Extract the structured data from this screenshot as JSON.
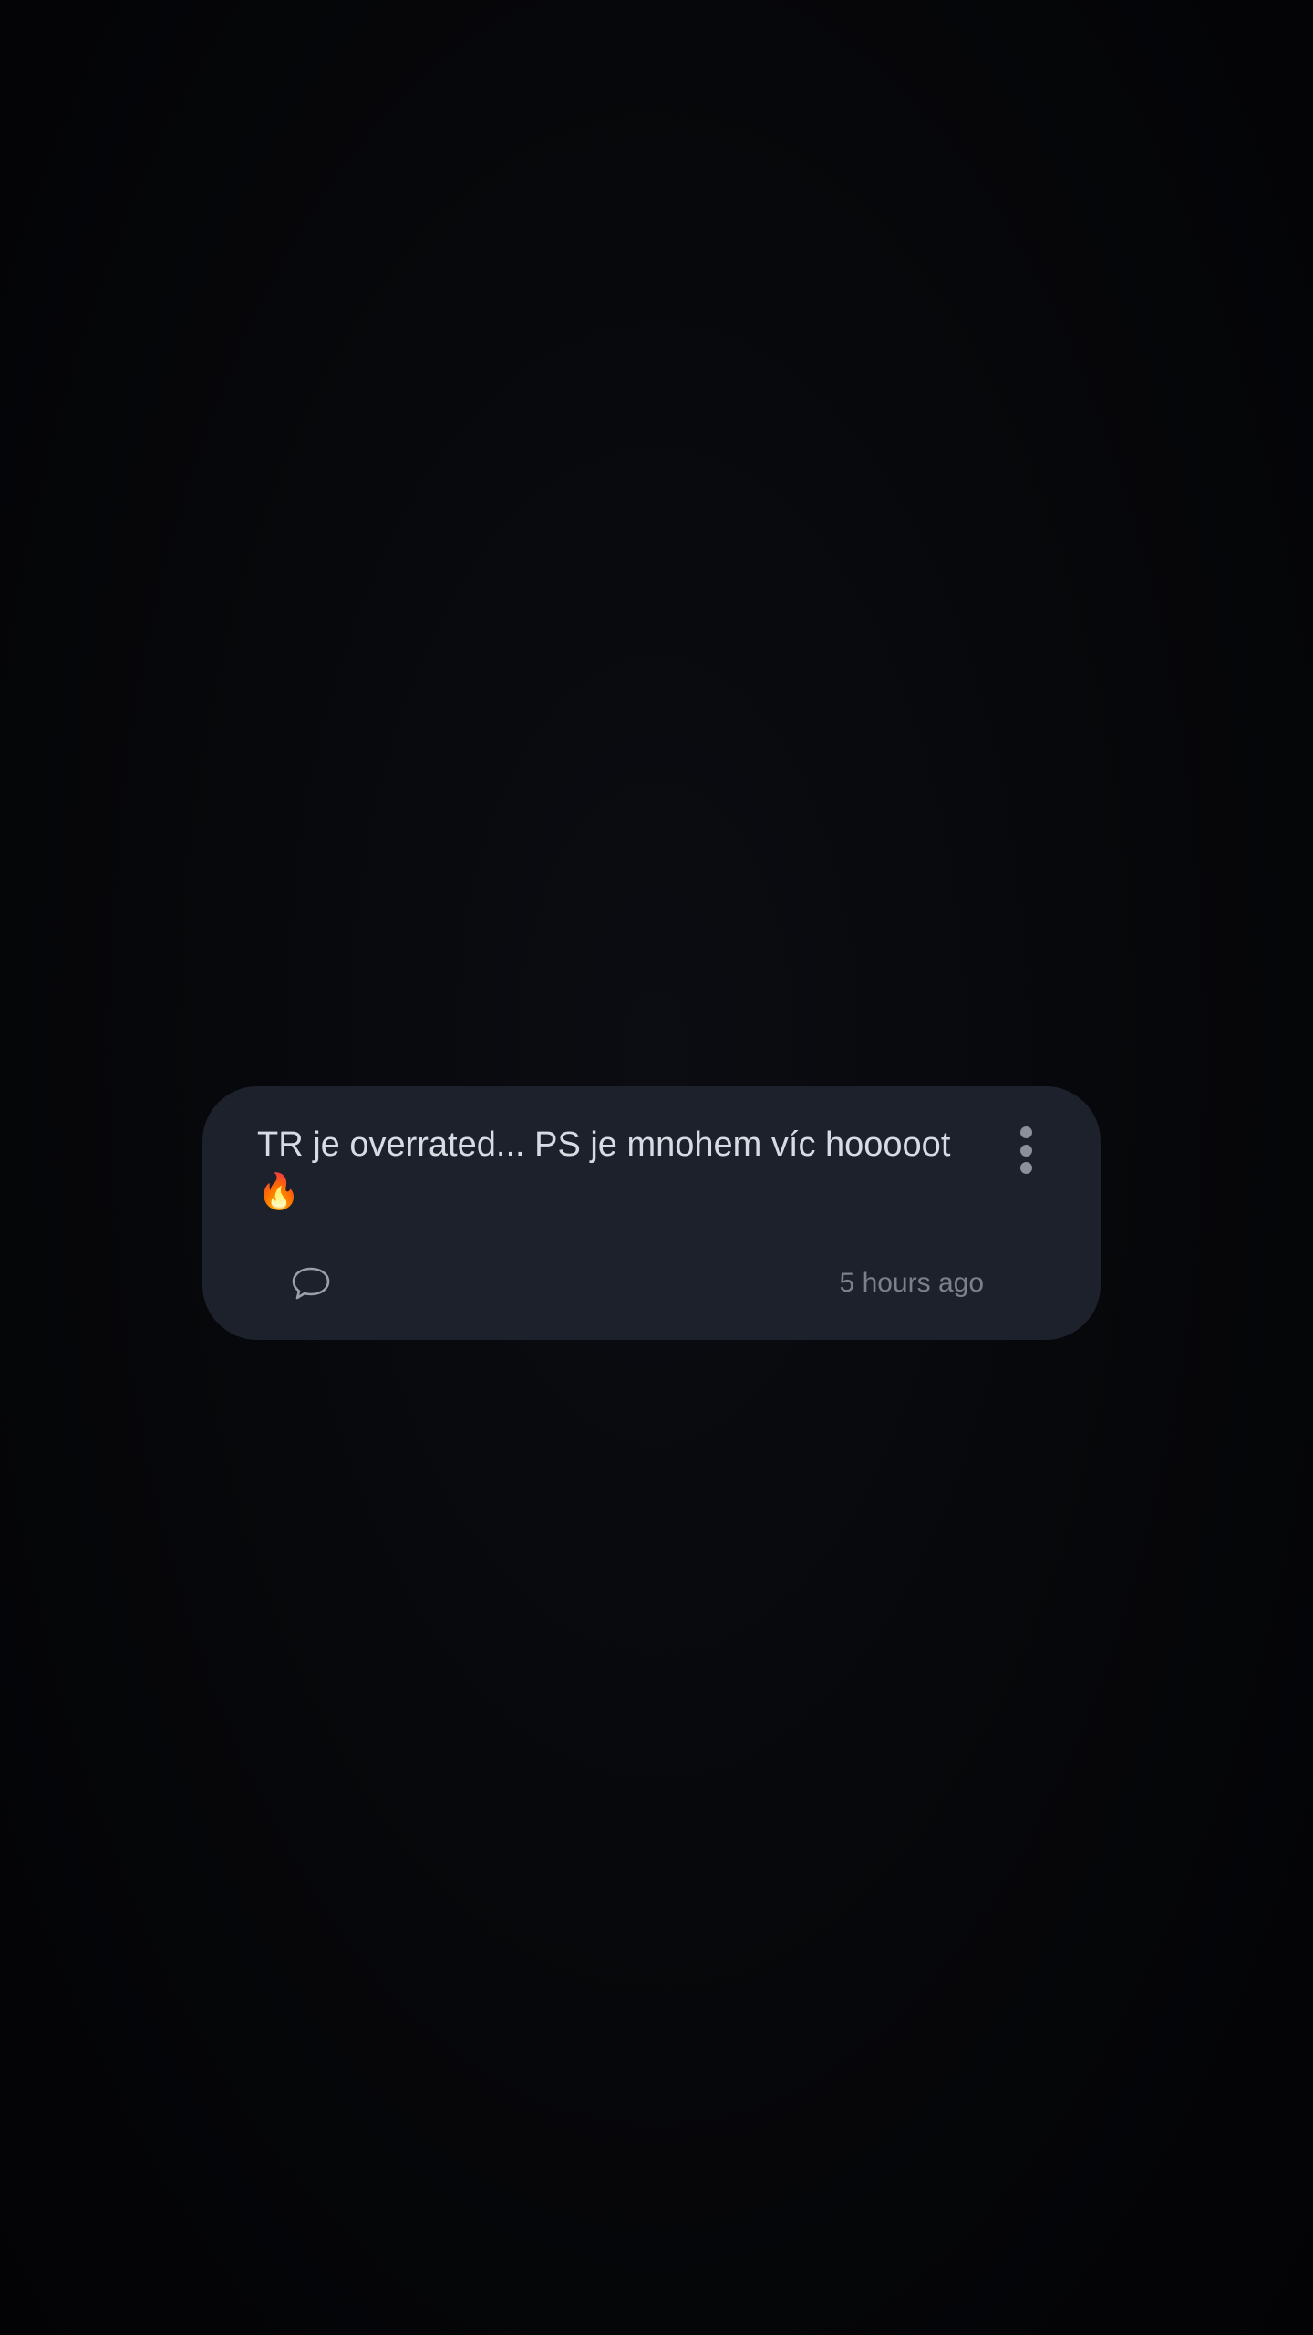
{
  "post": {
    "text": "TR je overrated... PS je mnohem víc hooooot 🔥",
    "timestamp": "5 hours ago"
  },
  "icons": {
    "more": "more-vertical-icon",
    "comment": "comment-bubble-icon"
  },
  "colors": {
    "background": "#040406",
    "card": "#1c212b",
    "text": "#d7dbe2",
    "muted": "#7b808a"
  }
}
